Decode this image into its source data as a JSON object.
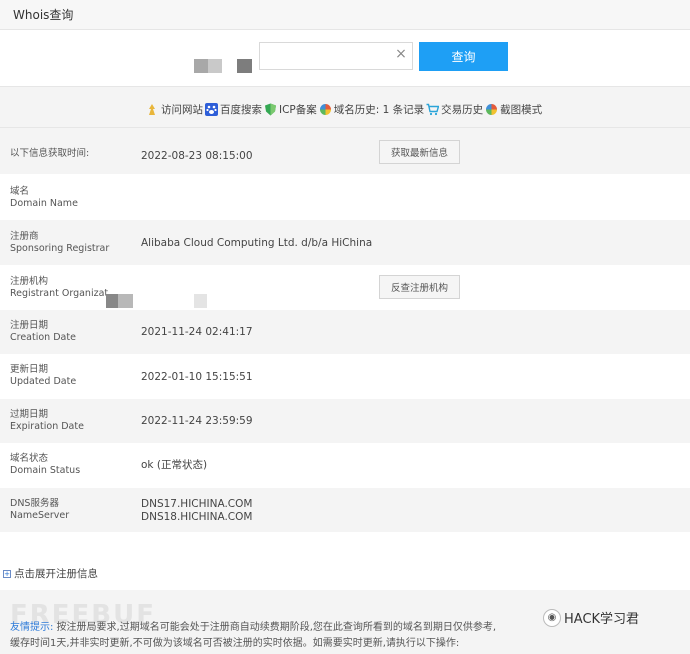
{
  "header": {
    "title": "Whois查询"
  },
  "search": {
    "value": "",
    "clear_icon": "×",
    "button_label": "查询"
  },
  "links": [
    {
      "label": "访问网站",
      "icon": "visit-website-icon",
      "color": "#e9b63b"
    },
    {
      "label": "百度搜索",
      "icon": "baidu-paw-icon",
      "color": "#2d5ed8"
    },
    {
      "label": "ICP备案",
      "icon": "shield-icon",
      "color": "#34a853"
    },
    {
      "label": "域名历史: 1 条记录",
      "icon": "color-wheel-icon",
      "color": "#e45b3c"
    },
    {
      "label": "交易历史",
      "icon": "cart-icon",
      "color": "#2aa4d8"
    },
    {
      "label": "截图模式",
      "icon": "color-wheel-icon",
      "color": "#e45b3c"
    }
  ],
  "fetch_row": {
    "label": "以下信息获取时间:",
    "value": "2022-08-23 08:15:00",
    "button": "获取最新信息"
  },
  "fields": {
    "domain": {
      "cn": "域名",
      "en": "Domain Name",
      "value": ""
    },
    "registrar": {
      "cn": "注册商",
      "en": "Sponsoring Registrar",
      "value": "Alibaba Cloud Computing Ltd. d/b/a HiChina"
    },
    "registrant": {
      "cn": "注册机构",
      "en": "Registrant Organizat",
      "value": "",
      "button": "反查注册机构"
    },
    "created": {
      "cn": "注册日期",
      "en": "Creation Date",
      "value": "2021-11-24 02:41:17"
    },
    "updated": {
      "cn": "更新日期",
      "en": "Updated Date",
      "value": "2022-01-10 15:15:51"
    },
    "expires": {
      "cn": "过期日期",
      "en": "Expiration Date",
      "value": "2022-11-24 23:59:59"
    },
    "status": {
      "cn": "域名状态",
      "en": "Domain Status",
      "value": "ok (正常状态)"
    },
    "dns": {
      "cn": "DNS服务器",
      "en": "NameServer",
      "ns1": "DNS17.HICHINA.COM",
      "ns2": "DNS18.HICHINA.COM"
    }
  },
  "expand": {
    "label": "点击展开注册信息"
  },
  "notice": {
    "lead": "友情提示:",
    "line1": " 按注册局要求,过期域名可能会处于注册商自动续费期阶段,您在此查询所看到的域名到期日仅供参考,",
    "line2": "缓存时间1天,并非实时更新,不可做为该域名可否被注册的实时依据。如需要实时更新,请执行以下操作:"
  },
  "watermark": {
    "left": "FREEBUF",
    "right": "HACK学习君"
  }
}
